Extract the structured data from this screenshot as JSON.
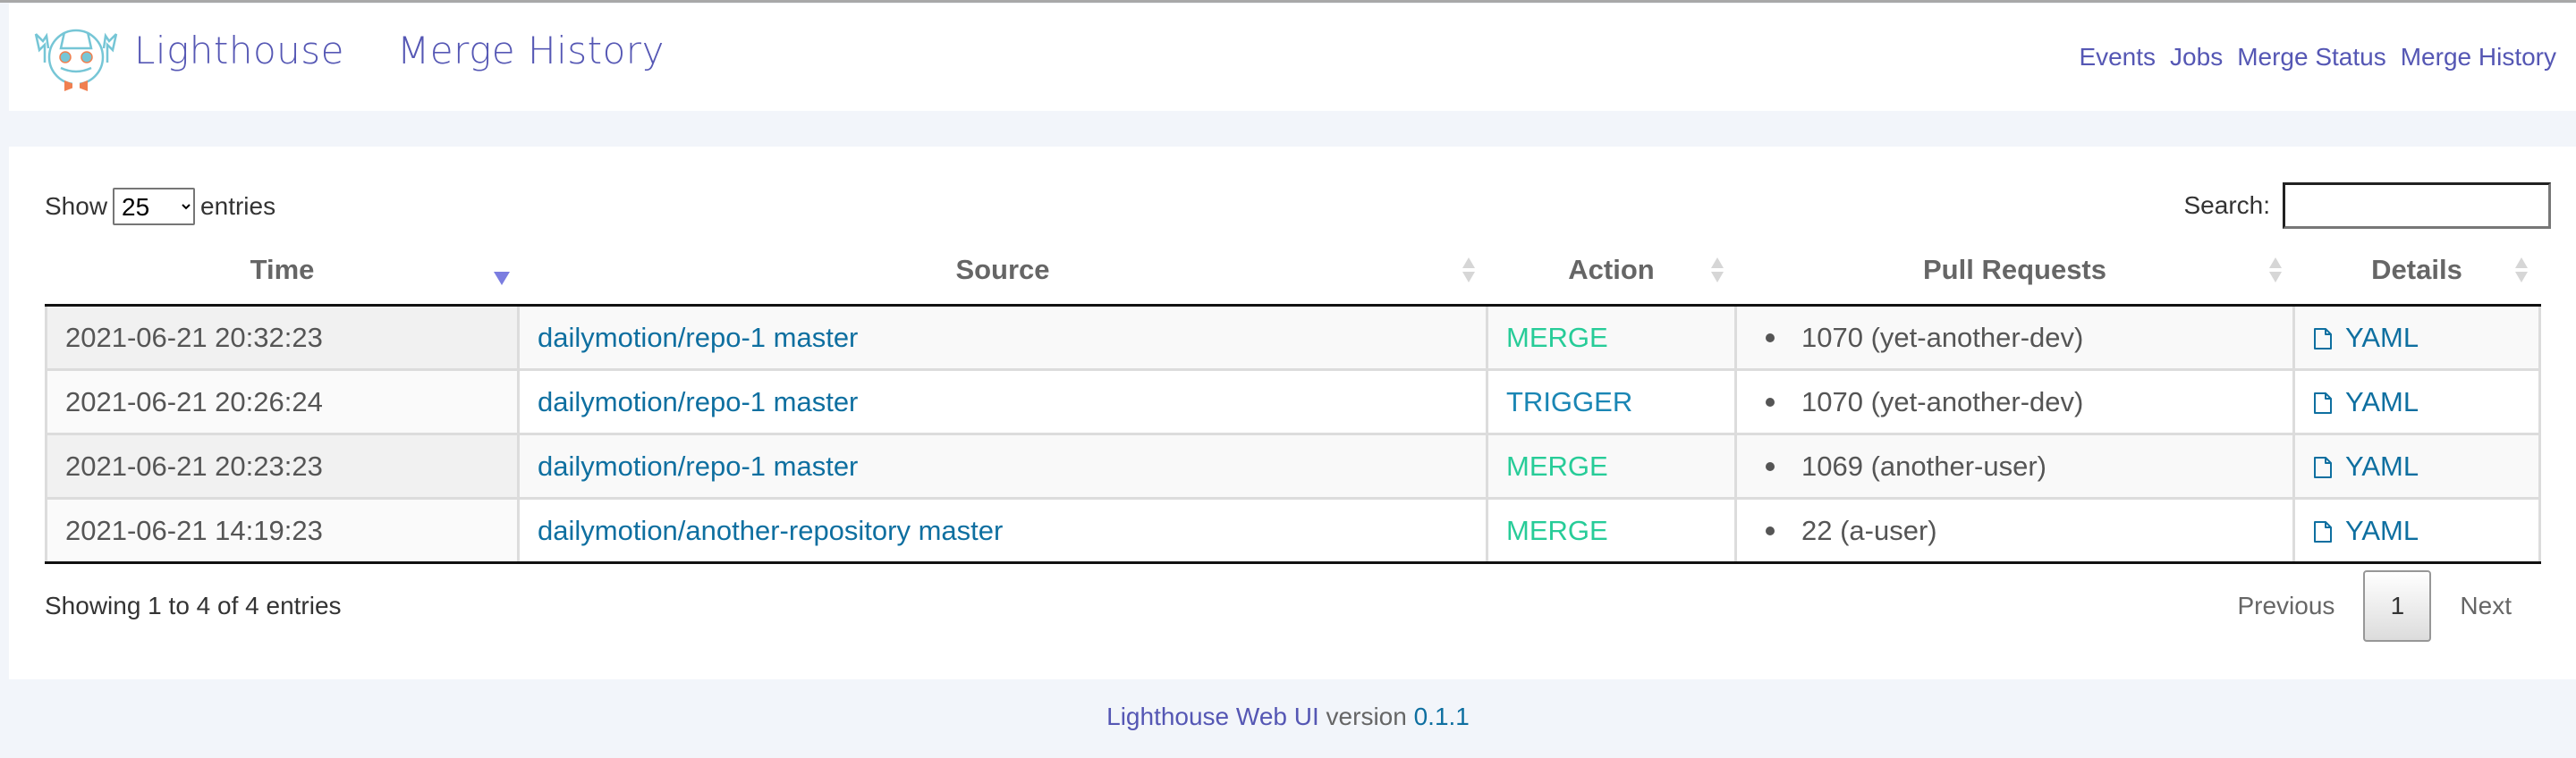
{
  "header": {
    "brand": "Lighthouse",
    "page_title": "Merge History",
    "logo_icon": "robot-logo-icon",
    "nav": [
      {
        "label": "Events"
      },
      {
        "label": "Jobs"
      },
      {
        "label": "Merge Status"
      },
      {
        "label": "Merge History"
      }
    ]
  },
  "controls": {
    "show_label": "Show",
    "entries_label": "entries",
    "page_length": "25",
    "search_label": "Search:",
    "search_value": "",
    "search_placeholder": ""
  },
  "table": {
    "columns": [
      {
        "label": "Time",
        "sort": "desc"
      },
      {
        "label": "Source",
        "sort": "none"
      },
      {
        "label": "Action",
        "sort": "none"
      },
      {
        "label": "Pull Requests",
        "sort": "none"
      },
      {
        "label": "Details",
        "sort": "none"
      }
    ],
    "rows": [
      {
        "time": "2021-06-21 20:32:23",
        "source": "dailymotion/repo-1 master",
        "action": "MERGE",
        "pull_request": "1070 (yet-another-dev)",
        "details": "YAML"
      },
      {
        "time": "2021-06-21 20:26:24",
        "source": "dailymotion/repo-1 master",
        "action": "TRIGGER",
        "pull_request": "1070 (yet-another-dev)",
        "details": "YAML"
      },
      {
        "time": "2021-06-21 20:23:23",
        "source": "dailymotion/repo-1 master",
        "action": "MERGE",
        "pull_request": "1069 (another-user)",
        "details": "YAML"
      },
      {
        "time": "2021-06-21 14:19:23",
        "source": "dailymotion/another-repository master",
        "action": "MERGE",
        "pull_request": "22 (a-user)",
        "details": "YAML"
      }
    ]
  },
  "footer_info": {
    "info": "Showing 1 to 4 of 4 entries",
    "previous": "Previous",
    "current_page": "1",
    "next": "Next"
  },
  "footer": {
    "app_name": "Lighthouse Web UI",
    "version_label": "version",
    "version": "0.1.1"
  },
  "colors": {
    "brand": "#5557b4",
    "link": "#0e6fa0",
    "merge": "#27cc98",
    "trigger": "#1a86b4",
    "background": "#f2f5fa"
  }
}
